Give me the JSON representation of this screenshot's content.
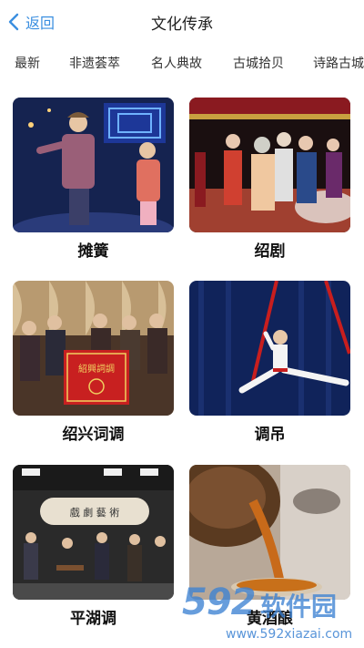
{
  "header": {
    "back_label": "返回",
    "title": "文化传承"
  },
  "tabs": [
    {
      "label": "最新"
    },
    {
      "label": "非遗荟萃",
      "active": true
    },
    {
      "label": "名人典故"
    },
    {
      "label": "古城拾贝"
    },
    {
      "label": "诗路古城"
    }
  ],
  "items": [
    {
      "label": "摊簧"
    },
    {
      "label": "绍剧"
    },
    {
      "label": "绍兴词调"
    },
    {
      "label": "调吊"
    },
    {
      "label": "平湖调"
    },
    {
      "label": "黄酒酿"
    }
  ],
  "watermark": {
    "logo": "592",
    "text": "软件园",
    "url": "www.592xiazai.com"
  },
  "colors": {
    "accent": "#3b8fe0",
    "tab_indicator": "#9a7b4a"
  }
}
